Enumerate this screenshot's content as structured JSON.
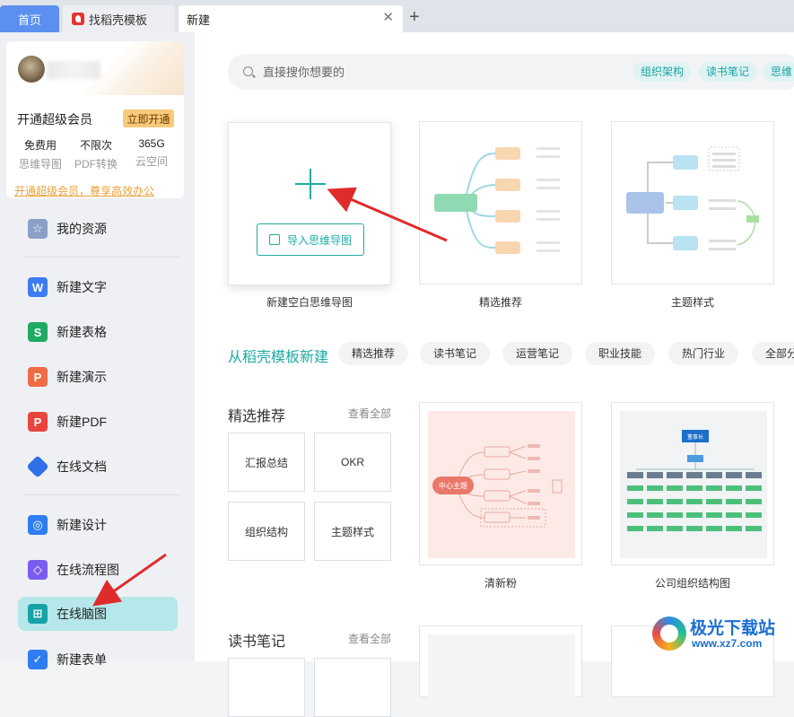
{
  "tabs": [
    {
      "label": "首页"
    },
    {
      "label": "找稻壳模板"
    },
    {
      "label": "新建"
    }
  ],
  "icons": {
    "tab_close": "close-icon",
    "tab_add": "plus-icon",
    "search": "search-icon",
    "blank_plus": "plus-icon",
    "import": "import-icon"
  },
  "user": {
    "vip_text": "开通超级会员",
    "vip_button": "立即开通",
    "perks": [
      {
        "value": "免费用",
        "label": "思维导图"
      },
      {
        "value": "不限次",
        "label": "PDF转换"
      },
      {
        "value": "365G",
        "label": "云空间"
      }
    ],
    "promo": "开通超级会员，尊享高效办公"
  },
  "sidebar": {
    "items": [
      {
        "label": "我的资源",
        "icon": "star-icon",
        "color": "#8aa0c8"
      },
      {
        "label": "新建文字",
        "icon": "w-doc-icon",
        "color": "#3c7cf0"
      },
      {
        "label": "新建表格",
        "icon": "s-sheet-icon",
        "color": "#20a962"
      },
      {
        "label": "新建演示",
        "icon": "p-slide-icon",
        "color": "#ef6b44"
      },
      {
        "label": "新建PDF",
        "icon": "pdf-icon",
        "color": "#e8453c"
      },
      {
        "label": "在线文档",
        "icon": "cloud-doc-icon",
        "color": "#2f6fe8"
      },
      {
        "label": "新建设计",
        "icon": "design-icon",
        "color": "#2f7df0"
      },
      {
        "label": "在线流程图",
        "icon": "flowchart-icon",
        "color": "#7b5cf0"
      },
      {
        "label": "在线脑图",
        "icon": "mindmap-icon",
        "color": "#16a3a6"
      },
      {
        "label": "新建表单",
        "icon": "form-icon",
        "color": "#2f7df0"
      }
    ],
    "active_index": 8
  },
  "search": {
    "placeholder": "直接搜你想要的",
    "tags": [
      "组织架构",
      "读书笔记",
      "思维"
    ]
  },
  "create": {
    "blank_caption": "新建空白思维导图",
    "import_label": "导入思维导图",
    "cards": [
      {
        "caption": "精选推荐"
      },
      {
        "caption": "主题样式"
      }
    ]
  },
  "templates": {
    "section_title": "从稻壳模板新建",
    "categories": [
      "精选推荐",
      "读书笔记",
      "运营笔记",
      "职业技能",
      "热门行业",
      "全部分"
    ]
  },
  "featured": {
    "title": "精选推荐",
    "view_all": "查看全部",
    "quick": [
      "汇报总结",
      "OKR",
      "组织结构",
      "主题样式"
    ],
    "cards": [
      {
        "caption": "清新粉",
        "center_label": "中心主题"
      },
      {
        "caption": "公司组织结构图",
        "root_label": "董事长"
      }
    ]
  },
  "reading": {
    "title": "读书笔记",
    "view_all": "查看全部"
  },
  "watermark": {
    "name": "极光下载站",
    "url": "www.xz7.com"
  },
  "colors": {
    "accent": "#1faaa5",
    "tab_home": "#5b8ff0",
    "annotation_arrow": "#e02b2b"
  }
}
